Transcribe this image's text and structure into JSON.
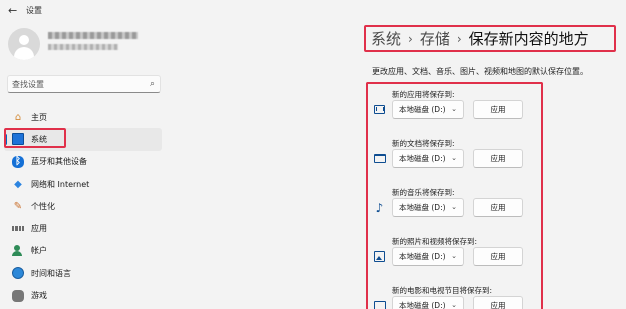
{
  "app": {
    "title": "设置"
  },
  "user": {
    "name": "████████████",
    "email": "██████████"
  },
  "search": {
    "placeholder": "查找设置"
  },
  "sidebar": {
    "items": [
      {
        "label": "主页",
        "icon": "home-icon"
      },
      {
        "label": "系统",
        "icon": "system-icon",
        "selected": true
      },
      {
        "label": "蓝牙和其他设备",
        "icon": "bluetooth-icon"
      },
      {
        "label": "网络和 Internet",
        "icon": "network-icon"
      },
      {
        "label": "个性化",
        "icon": "brush-icon"
      },
      {
        "label": "应用",
        "icon": "apps-icon"
      },
      {
        "label": "帐户",
        "icon": "account-icon"
      },
      {
        "label": "时间和语言",
        "icon": "globe-icon"
      },
      {
        "label": "游戏",
        "icon": "game-icon"
      }
    ]
  },
  "breadcrumb": {
    "items": [
      "系统",
      "存储",
      "保存新内容的地方"
    ],
    "separator": "›"
  },
  "main": {
    "description": "更改应用、文档、音乐、图片、视频和地图的默认保存位置。",
    "settings": [
      {
        "label": "新的应用将保存到:",
        "value": "本地磁盘 (D:)",
        "button": "应用",
        "icon": "app-window-icon"
      },
      {
        "label": "新的文档将保存到:",
        "value": "本地磁盘 (D:)",
        "button": "应用",
        "icon": "folder-icon"
      },
      {
        "label": "新的音乐将保存到:",
        "value": "本地磁盘 (D:)",
        "button": "应用",
        "icon": "music-note-icon"
      },
      {
        "label": "新的照片和视频将保存到:",
        "value": "本地磁盘 (D:)",
        "button": "应用",
        "icon": "photo-icon"
      },
      {
        "label": "新的电影和电视节目将保存到:",
        "value": "本地磁盘 (D:)",
        "button": "应用",
        "icon": "video-icon"
      }
    ]
  },
  "colors": {
    "accent": "#0067c0",
    "highlight": "#e0304a"
  }
}
